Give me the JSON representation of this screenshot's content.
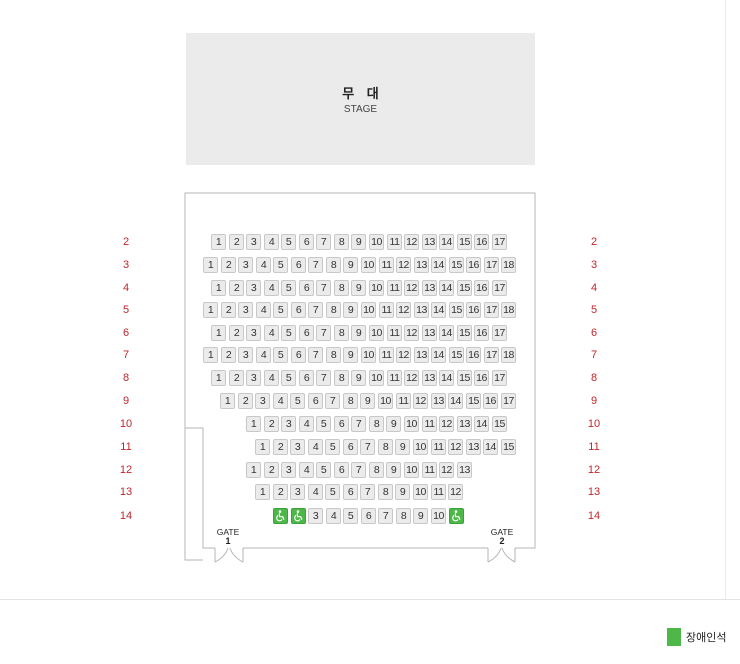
{
  "stage": {
    "title": "무 대",
    "subtitle": "STAGE"
  },
  "rows": [
    {
      "label": "2",
      "seats": [
        "1",
        "2",
        "3",
        "4",
        "5",
        "6",
        "7",
        "8",
        "9",
        "10",
        "11",
        "12",
        "13",
        "14",
        "15",
        "16",
        "17"
      ]
    },
    {
      "label": "3",
      "seats": [
        "1",
        "2",
        "3",
        "4",
        "5",
        "6",
        "7",
        "8",
        "9",
        "10",
        "11",
        "12",
        "13",
        "14",
        "15",
        "16",
        "17",
        "18"
      ]
    },
    {
      "label": "4",
      "seats": [
        "1",
        "2",
        "3",
        "4",
        "5",
        "6",
        "7",
        "8",
        "9",
        "10",
        "11",
        "12",
        "13",
        "14",
        "15",
        "16",
        "17"
      ]
    },
    {
      "label": "5",
      "seats": [
        "1",
        "2",
        "3",
        "4",
        "5",
        "6",
        "7",
        "8",
        "9",
        "10",
        "11",
        "12",
        "13",
        "14",
        "15",
        "16",
        "17",
        "18"
      ]
    },
    {
      "label": "6",
      "seats": [
        "1",
        "2",
        "3",
        "4",
        "5",
        "6",
        "7",
        "8",
        "9",
        "10",
        "11",
        "12",
        "13",
        "14",
        "15",
        "16",
        "17"
      ]
    },
    {
      "label": "7",
      "seats": [
        "1",
        "2",
        "3",
        "4",
        "5",
        "6",
        "7",
        "8",
        "9",
        "10",
        "11",
        "12",
        "13",
        "14",
        "15",
        "16",
        "17",
        "18"
      ]
    },
    {
      "label": "8",
      "seats": [
        "1",
        "2",
        "3",
        "4",
        "5",
        "6",
        "7",
        "8",
        "9",
        "10",
        "11",
        "12",
        "13",
        "14",
        "15",
        "16",
        "17"
      ]
    },
    {
      "label": "9",
      "seats": [
        "1",
        "2",
        "3",
        "4",
        "5",
        "6",
        "7",
        "8",
        "9",
        "10",
        "11",
        "12",
        "13",
        "14",
        "15",
        "16",
        "17"
      ]
    },
    {
      "label": "10",
      "seats": [
        "1",
        "2",
        "3",
        "4",
        "5",
        "6",
        "7",
        "8",
        "9",
        "10",
        "11",
        "12",
        "13",
        "14",
        "15"
      ]
    },
    {
      "label": "11",
      "seats": [
        "1",
        "2",
        "3",
        "4",
        "5",
        "6",
        "7",
        "8",
        "9",
        "10",
        "11",
        "12",
        "13",
        "14",
        "15"
      ]
    },
    {
      "label": "12",
      "seats": [
        "1",
        "2",
        "3",
        "4",
        "5",
        "6",
        "7",
        "8",
        "9",
        "10",
        "11",
        "12",
        "13"
      ]
    },
    {
      "label": "13",
      "seats": [
        "1",
        "2",
        "3",
        "4",
        "5",
        "6",
        "7",
        "8",
        "9",
        "10",
        "11",
        "12"
      ]
    },
    {
      "label": "14",
      "seats": [
        "wheelchair",
        "wheelchair",
        "3",
        "4",
        "5",
        "6",
        "7",
        "8",
        "9",
        "10",
        "wheelchair"
      ]
    }
  ],
  "gates": [
    {
      "label": "GATE",
      "number": "1"
    },
    {
      "label": "GATE",
      "number": "2"
    }
  ],
  "legend": {
    "label": "장애인석",
    "color": "#4db848"
  },
  "colors": {
    "row_label": "#c1272d",
    "seat_fill": "#ebebeb",
    "accessible_seat": "#4db848",
    "stage_fill": "#ebebeb"
  }
}
